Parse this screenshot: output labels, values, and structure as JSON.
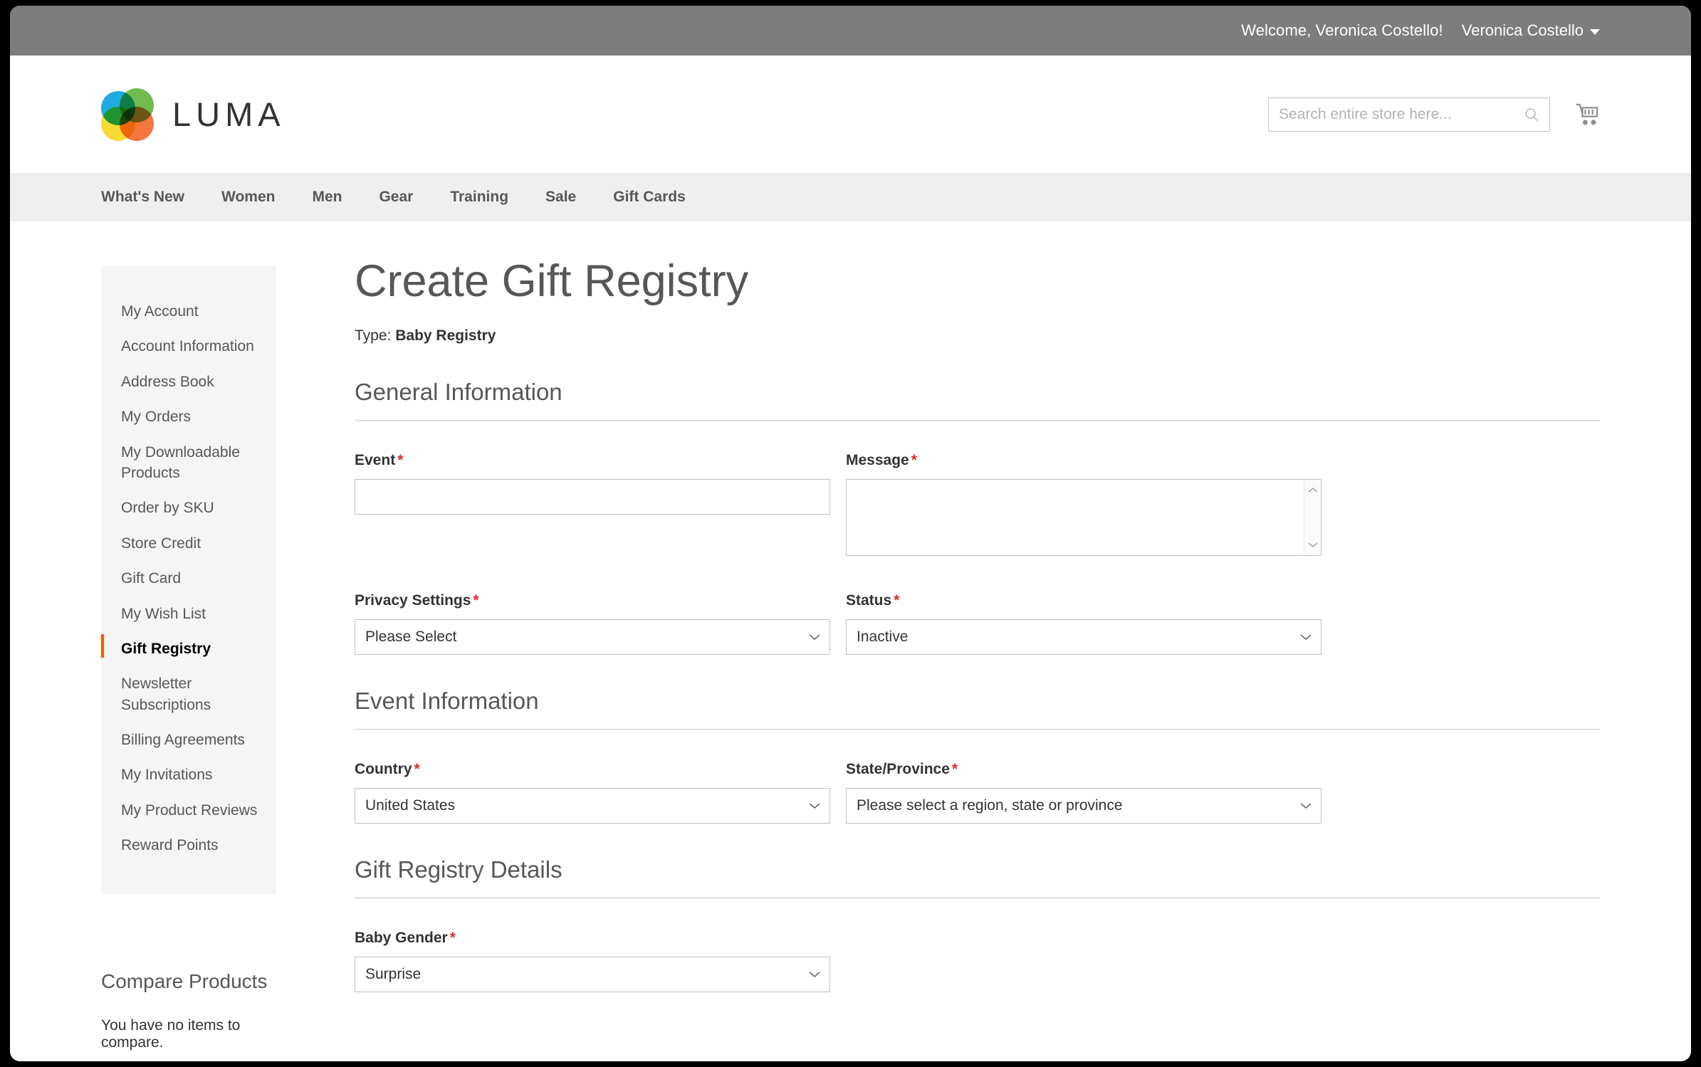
{
  "topbar": {
    "welcome": "Welcome, Veronica Costello!",
    "account_name": "Veronica Costello",
    "caret_icon": "chevron-down-icon"
  },
  "header": {
    "logo_text": "LUMA",
    "logo_icon": "luma-logo-icon",
    "search": {
      "placeholder": "Search entire store here...",
      "value": "",
      "icon": "search-icon"
    },
    "cart_icon": "shopping-cart-icon"
  },
  "nav": {
    "items": [
      {
        "label": "What's New"
      },
      {
        "label": "Women"
      },
      {
        "label": "Men"
      },
      {
        "label": "Gear"
      },
      {
        "label": "Training"
      },
      {
        "label": "Sale"
      },
      {
        "label": "Gift Cards"
      }
    ]
  },
  "sidebar": {
    "items": [
      {
        "label": "My Account",
        "active": false
      },
      {
        "label": "Account Information",
        "active": false
      },
      {
        "label": "Address Book",
        "active": false
      },
      {
        "label": "My Orders",
        "active": false
      },
      {
        "label": "My Downloadable Products",
        "active": false
      },
      {
        "label": "Order by SKU",
        "active": false
      },
      {
        "label": "Store Credit",
        "active": false
      },
      {
        "label": "Gift Card",
        "active": false
      },
      {
        "label": "My Wish List",
        "active": false
      },
      {
        "label": "Gift Registry",
        "active": true
      },
      {
        "label": "Newsletter Subscriptions",
        "active": false
      },
      {
        "label": "Billing Agreements",
        "active": false
      },
      {
        "label": "My Invitations",
        "active": false
      },
      {
        "label": "My Product Reviews",
        "active": false
      },
      {
        "label": "Reward Points",
        "active": false
      }
    ],
    "compare": {
      "title": "Compare Products",
      "empty_text": "You have no items to compare."
    }
  },
  "main": {
    "page_title": "Create Gift Registry",
    "type_label": "Type:",
    "type_value": "Baby Registry",
    "required_marker": "*",
    "sections": [
      {
        "legend": "General Information",
        "fields": [
          {
            "label": "Event",
            "required": true,
            "control": "text",
            "value": "",
            "name": "event-input"
          },
          {
            "label": "Message",
            "required": true,
            "control": "textarea",
            "value": "",
            "name": "message-textarea"
          },
          {
            "label": "Privacy Settings",
            "required": true,
            "control": "select",
            "value": "Please Select",
            "name": "privacy-settings-select"
          },
          {
            "label": "Status",
            "required": true,
            "control": "select",
            "value": "Inactive",
            "name": "status-select"
          }
        ]
      },
      {
        "legend": "Event Information",
        "fields": [
          {
            "label": "Country",
            "required": true,
            "control": "select",
            "value": "United States",
            "name": "country-select"
          },
          {
            "label": "State/Province",
            "required": true,
            "control": "select",
            "value": "Please select a region, state or province",
            "name": "state-province-select"
          }
        ]
      },
      {
        "legend": "Gift Registry Details",
        "fields": [
          {
            "label": "Baby Gender",
            "required": true,
            "control": "select",
            "value": "Surprise",
            "name": "baby-gender-select"
          }
        ]
      }
    ]
  },
  "colors": {
    "accent": "#ff5501",
    "topbar_bg": "#7d7d7d",
    "nav_bg": "#efefef",
    "sidebar_bg": "#f5f5f5",
    "required_red": "#e02b27",
    "text": "#333333",
    "muted_text": "#575757"
  }
}
